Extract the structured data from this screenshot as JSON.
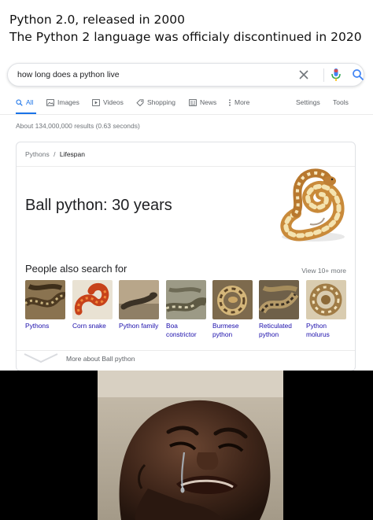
{
  "caption": {
    "line1": "Python 2.0, released in 2000",
    "line2": "The Python 2 language was officialy discontinued in 2020"
  },
  "search": {
    "query": "how long does a python live",
    "icons": [
      "close-icon",
      "microphone-icon",
      "search-icon"
    ],
    "colors": {
      "mic_blue": "#4285f4",
      "mic_red": "#ea4335",
      "search_blue": "#1a73e8"
    }
  },
  "tabs": [
    {
      "label": "All",
      "icon": "search-icon",
      "active": true
    },
    {
      "label": "Images",
      "icon": "image-icon"
    },
    {
      "label": "Videos",
      "icon": "video-icon"
    },
    {
      "label": "Shopping",
      "icon": "tag-icon"
    },
    {
      "label": "News",
      "icon": "news-icon"
    },
    {
      "label": "More",
      "icon": "more-vertical-icon"
    }
  ],
  "tools": {
    "settings": "Settings",
    "tools": "Tools"
  },
  "results_stats": "About 134,000,000 results (0.63 seconds)",
  "knowledge_panel": {
    "breadcrumb_root": "Pythons",
    "breadcrumb_separator": "/",
    "breadcrumb_current": "Lifespan",
    "answer": "Ball python: 30 years",
    "people_also_search_title": "People also search for",
    "view_more": "View 10+ more",
    "related": [
      {
        "label": "Pythons"
      },
      {
        "label": "Corn snake"
      },
      {
        "label": "Python family"
      },
      {
        "label": "Boa constrictor"
      },
      {
        "label": "Burmese python"
      },
      {
        "label": "Reticulated python"
      },
      {
        "label": "Python molurus"
      }
    ],
    "more_about": "More about Ball python"
  },
  "colors": {
    "link": "#1a0dab",
    "active_tab": "#1a73e8",
    "muted": "#70757a"
  }
}
